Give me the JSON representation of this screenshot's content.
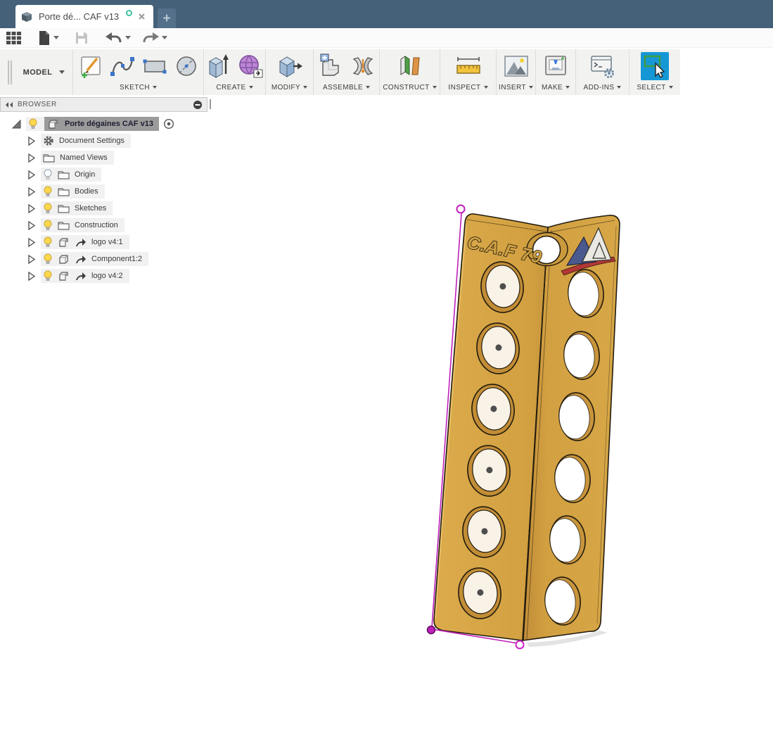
{
  "tab_bar": {
    "document_title": "Porte dé... CAF v13",
    "new_tab_glyph": "+"
  },
  "ribbon": {
    "workspace": "MODEL",
    "groups": [
      {
        "label": "SKETCH"
      },
      {
        "label": "CREATE"
      },
      {
        "label": "MODIFY"
      },
      {
        "label": "ASSEMBLE"
      },
      {
        "label": "CONSTRUCT"
      },
      {
        "label": "INSPECT"
      },
      {
        "label": "INSERT"
      },
      {
        "label": "MAKE"
      },
      {
        "label": "ADD-INS"
      },
      {
        "label": "SELECT"
      }
    ]
  },
  "browser": {
    "title": "BROWSER",
    "root": {
      "label": "Porte dégaines CAF v13"
    },
    "items": [
      {
        "label": "Document Settings",
        "icon": "gear",
        "bulb": "none",
        "linked": false
      },
      {
        "label": "Named Views",
        "icon": "folder",
        "bulb": "none",
        "linked": false
      },
      {
        "label": "Origin",
        "icon": "folder",
        "bulb": "off",
        "linked": false
      },
      {
        "label": "Bodies",
        "icon": "folder",
        "bulb": "on",
        "linked": false
      },
      {
        "label": "Sketches",
        "icon": "folder",
        "bulb": "on",
        "linked": false
      },
      {
        "label": "Construction",
        "icon": "folder",
        "bulb": "on",
        "linked": false
      },
      {
        "label": "logo v4:1",
        "icon": "component",
        "bulb": "on",
        "linked": true
      },
      {
        "label": "Component1:2",
        "icon": "component-single",
        "bulb": "on",
        "linked": true
      },
      {
        "label": "logo v4:2",
        "icon": "component",
        "bulb": "on",
        "linked": true
      }
    ]
  },
  "viewport": {
    "engraving": "C.A.F 79"
  },
  "colors": {
    "tabbar": "#45617a",
    "plate_gold": "#d5a343",
    "sketch_magenta": "#bf1fba",
    "select_accent": "#1697d5",
    "unsaved_teal": "#3ec3a4"
  }
}
